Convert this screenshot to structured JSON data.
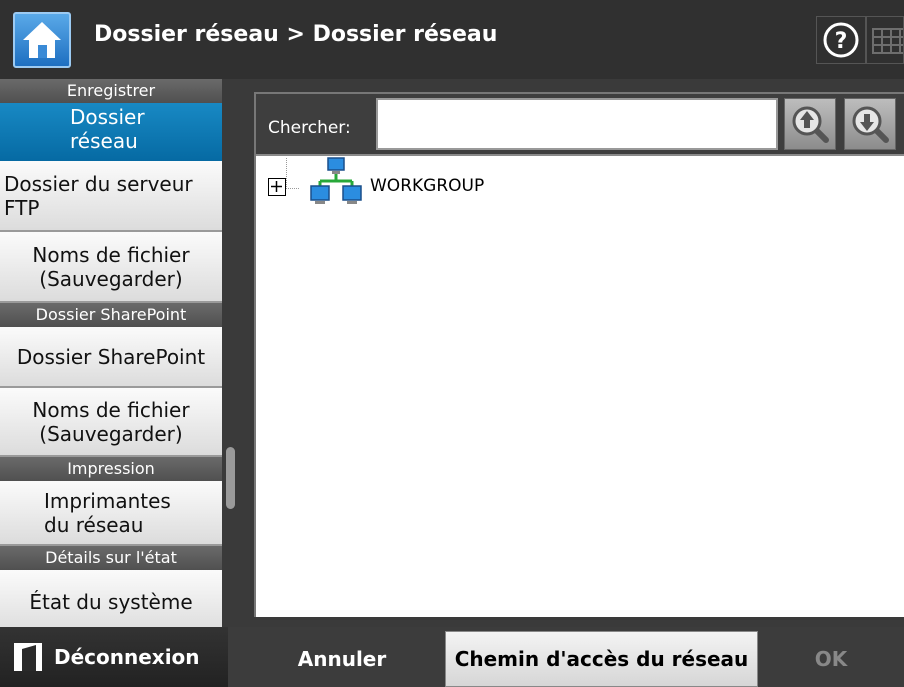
{
  "header": {
    "title": "Dossier réseau > Dossier réseau",
    "help_icon": "?"
  },
  "sidebar": {
    "sections": [
      {
        "title": "Enregistrer",
        "items": [
          "Dossier\nréseau",
          "Dossier du serveur\nFTP",
          "Noms de fichier\n(Sauvegarder)"
        ]
      },
      {
        "title": "Dossier SharePoint",
        "items": [
          "Dossier SharePoint",
          "Noms de fichier\n(Sauvegarder)"
        ]
      },
      {
        "title": "Impression",
        "items": [
          "Imprimantes\ndu réseau"
        ]
      },
      {
        "title": "Détails sur l'état",
        "items": [
          "État du système"
        ]
      }
    ],
    "selected": "Dossier réseau"
  },
  "search": {
    "label": "Chercher:",
    "value": ""
  },
  "tree": {
    "items": [
      {
        "label": "WORKGROUP",
        "expanded": false
      }
    ]
  },
  "footer": {
    "logout_label": "Déconnexion",
    "cancel_label": "Annuler",
    "path_label": "Chemin d'accès du réseau",
    "ok_label": "OK"
  },
  "colors": {
    "accent": "#0a77b3",
    "header_bg": "#303030"
  }
}
